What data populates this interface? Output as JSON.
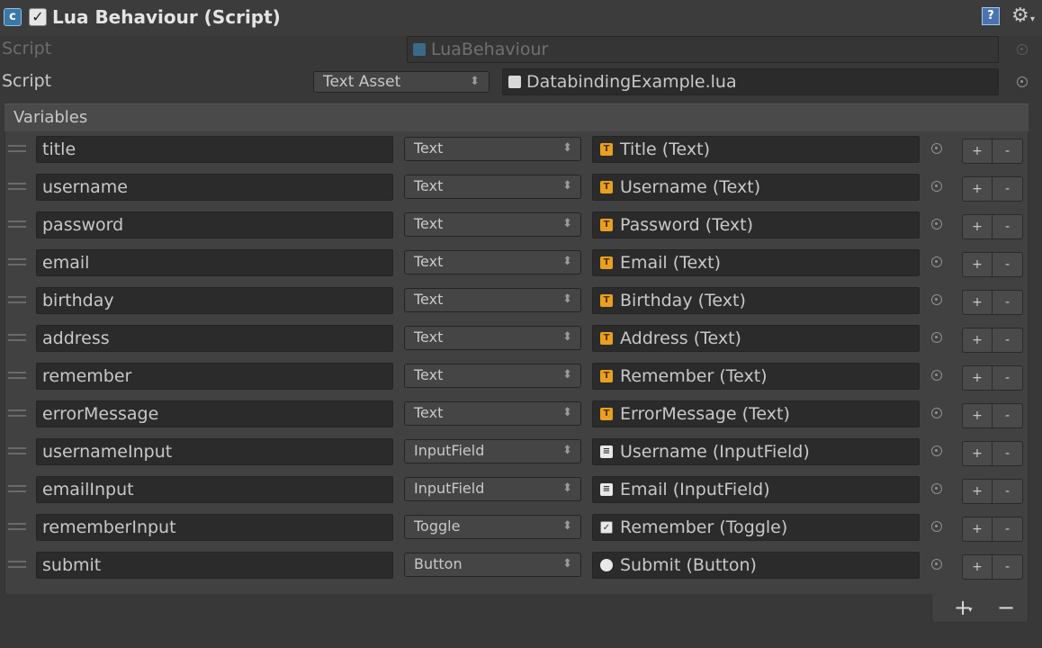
{
  "component": {
    "title": "Lua Behaviour (Script)",
    "icon": "script-component-icon",
    "enabled": true
  },
  "script_ref": {
    "label": "Script",
    "value": "LuaBehaviour"
  },
  "script_source": {
    "label": "Script",
    "mode": "Text Asset",
    "file": "DatabindingExample.lua"
  },
  "variables": {
    "header": "Variables",
    "rows": [
      {
        "name": "title",
        "type": "Text",
        "target": "Title (Text)",
        "icon": "text-icon",
        "add": "+",
        "remove": "-"
      },
      {
        "name": "username",
        "type": "Text",
        "target": "Username (Text)",
        "icon": "text-icon",
        "add": "+",
        "remove": "-"
      },
      {
        "name": "password",
        "type": "Text",
        "target": "Password (Text)",
        "icon": "text-icon",
        "add": "+",
        "remove": "-"
      },
      {
        "name": "email",
        "type": "Text",
        "target": "Email (Text)",
        "icon": "text-icon",
        "add": "+",
        "remove": "-"
      },
      {
        "name": "birthday",
        "type": "Text",
        "target": "Birthday (Text)",
        "icon": "text-icon",
        "add": "+",
        "remove": "-"
      },
      {
        "name": "address",
        "type": "Text",
        "target": "Address (Text)",
        "icon": "text-icon",
        "add": "+",
        "remove": "-"
      },
      {
        "name": "remember",
        "type": "Text",
        "target": "Remember (Text)",
        "icon": "text-icon",
        "add": "+",
        "remove": "-"
      },
      {
        "name": "errorMessage",
        "type": "Text",
        "target": "ErrorMessage (Text)",
        "icon": "text-icon",
        "add": "+",
        "remove": "-"
      },
      {
        "name": "usernameInput",
        "type": "InputField",
        "target": "Username (InputField)",
        "icon": "inputfield-icon",
        "add": "+",
        "remove": "-"
      },
      {
        "name": "emailInput",
        "type": "InputField",
        "target": "Email (InputField)",
        "icon": "inputfield-icon",
        "add": "+",
        "remove": "-"
      },
      {
        "name": "rememberInput",
        "type": "Toggle",
        "target": "Remember (Toggle)",
        "icon": "toggle-icon",
        "add": "+",
        "remove": "-"
      },
      {
        "name": "submit",
        "type": "Button",
        "target": "Submit (Button)",
        "icon": "button-icon",
        "add": "+",
        "remove": "-"
      }
    ]
  },
  "footer": {
    "add": "+",
    "remove": "−"
  }
}
